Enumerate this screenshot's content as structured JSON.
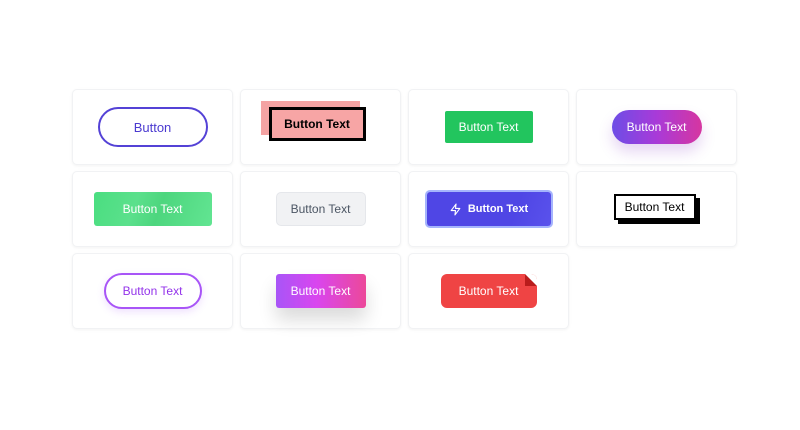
{
  "buttons": [
    {
      "label": "Button"
    },
    {
      "label": "Button Text"
    },
    {
      "label": "Button Text"
    },
    {
      "label": "Button Text"
    },
    {
      "label": "Button Text"
    },
    {
      "label": "Button Text"
    },
    {
      "label": "Button Text",
      "icon": "lightning-icon"
    },
    {
      "label": "Button Text"
    },
    {
      "label": "Button Text"
    },
    {
      "label": "Button Text"
    },
    {
      "label": "Button Text"
    }
  ],
  "colors": {
    "indigo": "#4b3ad0",
    "salmon": "#f7a5a5",
    "green": "#22c55e",
    "light_green": "#4ade80",
    "gray_bg": "#f1f2f4",
    "indigo_solid": "#4f46e5",
    "purple": "#a855f7",
    "pink": "#ec4899",
    "red": "#ef4444"
  }
}
